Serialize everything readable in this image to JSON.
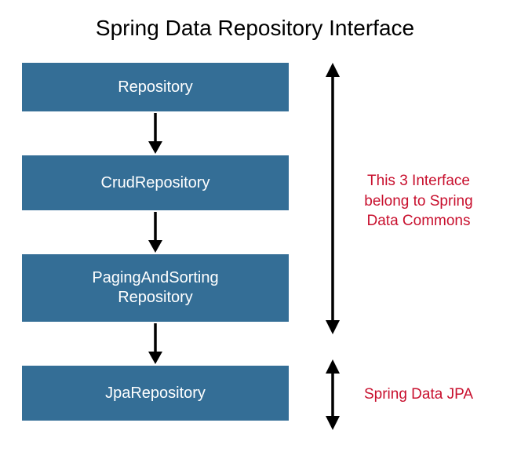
{
  "title": "Spring Data Repository Interface",
  "boxes": {
    "b1": "Repository",
    "b2": "CrudRepository",
    "b3_line1": "PagingAndSorting",
    "b3_line2": "Repository",
    "b4": "JpaRepository"
  },
  "labels": {
    "commons_line1": "This 3 Interface",
    "commons_line2": "belong to Spring",
    "commons_line3": "Data Commons",
    "jpa": "Spring Data JPA"
  },
  "colors": {
    "box_bg": "#346e96",
    "label_red": "#c8102e"
  }
}
